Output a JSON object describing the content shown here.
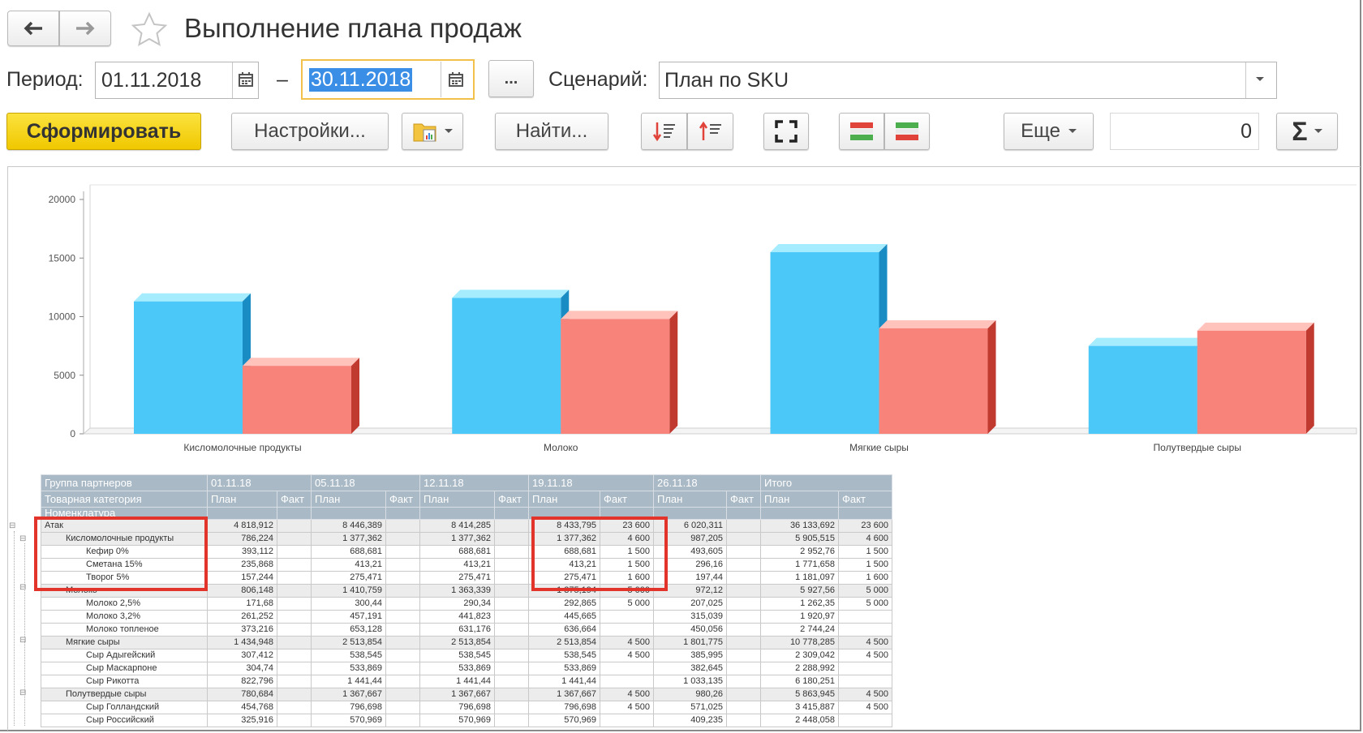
{
  "window": {
    "title": "Выполнение плана продаж"
  },
  "nav": {
    "back_icon": "arrow-left-icon",
    "forward_icon": "arrow-right-icon",
    "favorite_icon": "star-icon"
  },
  "filters": {
    "period_label": "Период:",
    "date_from": "01.11.2018",
    "dash": "–",
    "date_to": "30.11.2018",
    "choose_button": "...",
    "scenario_label": "Сценарий:",
    "scenario_value": "План по SKU"
  },
  "toolbar": {
    "generate": "Сформировать",
    "settings": "Настройки...",
    "find": "Найти...",
    "more": "Еще",
    "sum_value": "0",
    "sum_symbol": "Σ"
  },
  "colors": {
    "plan": "#4cc8f8",
    "fact": "#f7837a",
    "generate_btn": "#f5d10f",
    "highlight": "#e2342a",
    "header": "#a9b9c6"
  },
  "chart_data": {
    "type": "bar",
    "categories": [
      "Кисломолочные продукты",
      "Молоко",
      "Мягкие сыры",
      "Полутвердые сыры"
    ],
    "series": [
      {
        "values": [
          11300,
          11600,
          15500,
          7500
        ]
      },
      {
        "values": [
          5800,
          9800,
          9000,
          8800
        ]
      }
    ],
    "ylim": [
      0,
      20000
    ],
    "yticks": [
      "0",
      "5000",
      "10000",
      "15000",
      "20000"
    ],
    "grid": false
  },
  "table": {
    "header_row1": [
      "Группа партнеров",
      "01.11.18",
      "05.11.18",
      "12.11.18",
      "19.11.18",
      "26.11.18",
      "Итого"
    ],
    "header_row2": [
      "Товарная категория",
      "План",
      "Факт",
      "План",
      "Факт",
      "План",
      "Факт",
      "План",
      "Факт",
      "План",
      "Факт",
      "План",
      "Факт"
    ],
    "header_row3": [
      "Номенклатура"
    ],
    "rows": [
      {
        "level": 0,
        "cells": [
          "Атак",
          "4 818,912",
          "",
          "8 446,389",
          "",
          "8 414,285",
          "",
          "8 433,795",
          "23 600",
          "6 020,311",
          "",
          "36 133,692",
          "23 600"
        ]
      },
      {
        "level": 1,
        "cells": [
          "Кисломолочные продукты",
          "786,224",
          "",
          "1 377,362",
          "",
          "1 377,362",
          "",
          "1 377,362",
          "4 600",
          "987,205",
          "",
          "5 905,515",
          "4 600"
        ]
      },
      {
        "level": 2,
        "cells": [
          "Кефир 0%",
          "393,112",
          "",
          "688,681",
          "",
          "688,681",
          "",
          "688,681",
          "1 500",
          "493,605",
          "",
          "2 952,76",
          "1 500"
        ]
      },
      {
        "level": 2,
        "cells": [
          "Сметана 15%",
          "235,868",
          "",
          "413,21",
          "",
          "413,21",
          "",
          "413,21",
          "1 500",
          "296,16",
          "",
          "1 771,658",
          "1 500"
        ]
      },
      {
        "level": 2,
        "cells": [
          "Творог 5%",
          "157,244",
          "",
          "275,471",
          "",
          "275,471",
          "",
          "275,471",
          "1 600",
          "197,44",
          "",
          "1 181,097",
          "1 600"
        ]
      },
      {
        "level": 1,
        "cells": [
          "Молоко",
          "806,148",
          "",
          "1 410,759",
          "",
          "1 363,339",
          "",
          "1 375,194",
          "5 000",
          "972,12",
          "",
          "5 927,56",
          "5 000"
        ]
      },
      {
        "level": 2,
        "cells": [
          "Молоко 2,5%",
          "171,68",
          "",
          "300,44",
          "",
          "290,34",
          "",
          "292,865",
          "5 000",
          "207,025",
          "",
          "1 262,35",
          "5 000"
        ]
      },
      {
        "level": 2,
        "cells": [
          "Молоко 3,2%",
          "261,252",
          "",
          "457,191",
          "",
          "441,823",
          "",
          "445,665",
          "",
          "315,039",
          "",
          "1 920,97",
          ""
        ]
      },
      {
        "level": 2,
        "cells": [
          "Молоко топленое",
          "373,216",
          "",
          "653,128",
          "",
          "631,176",
          "",
          "636,664",
          "",
          "450,056",
          "",
          "2 744,24",
          ""
        ]
      },
      {
        "level": 1,
        "cells": [
          "Мягкие сыры",
          "1 434,948",
          "",
          "2 513,854",
          "",
          "2 513,854",
          "",
          "2 513,854",
          "4 500",
          "1 801,775",
          "",
          "10 778,285",
          "4 500"
        ]
      },
      {
        "level": 2,
        "cells": [
          "Сыр Адыгейский",
          "307,412",
          "",
          "538,545",
          "",
          "538,545",
          "",
          "538,545",
          "4 500",
          "385,995",
          "",
          "2 309,042",
          "4 500"
        ]
      },
      {
        "level": 2,
        "cells": [
          "Сыр Маскарпоне",
          "304,74",
          "",
          "533,869",
          "",
          "533,869",
          "",
          "533,869",
          "",
          "382,645",
          "",
          "2 288,992",
          ""
        ]
      },
      {
        "level": 2,
        "cells": [
          "Сыр Рикотта",
          "822,796",
          "",
          "1 441,44",
          "",
          "1 441,44",
          "",
          "1 441,44",
          "",
          "1 033,135",
          "",
          "6 180,251",
          ""
        ]
      },
      {
        "level": 1,
        "cells": [
          "Полутвердые сыры",
          "780,684",
          "",
          "1 367,667",
          "",
          "1 367,667",
          "",
          "1 367,667",
          "4 500",
          "980,26",
          "",
          "5 863,945",
          "4 500"
        ]
      },
      {
        "level": 2,
        "cells": [
          "Сыр Голландский",
          "454,768",
          "",
          "796,698",
          "",
          "796,698",
          "",
          "796,698",
          "4 500",
          "571,025",
          "",
          "3 415,887",
          "4 500"
        ]
      },
      {
        "level": 2,
        "cells": [
          "Сыр Российский",
          "325,916",
          "",
          "570,969",
          "",
          "570,969",
          "",
          "570,969",
          "",
          "409,235",
          "",
          "2 448,058",
          ""
        ]
      }
    ]
  }
}
